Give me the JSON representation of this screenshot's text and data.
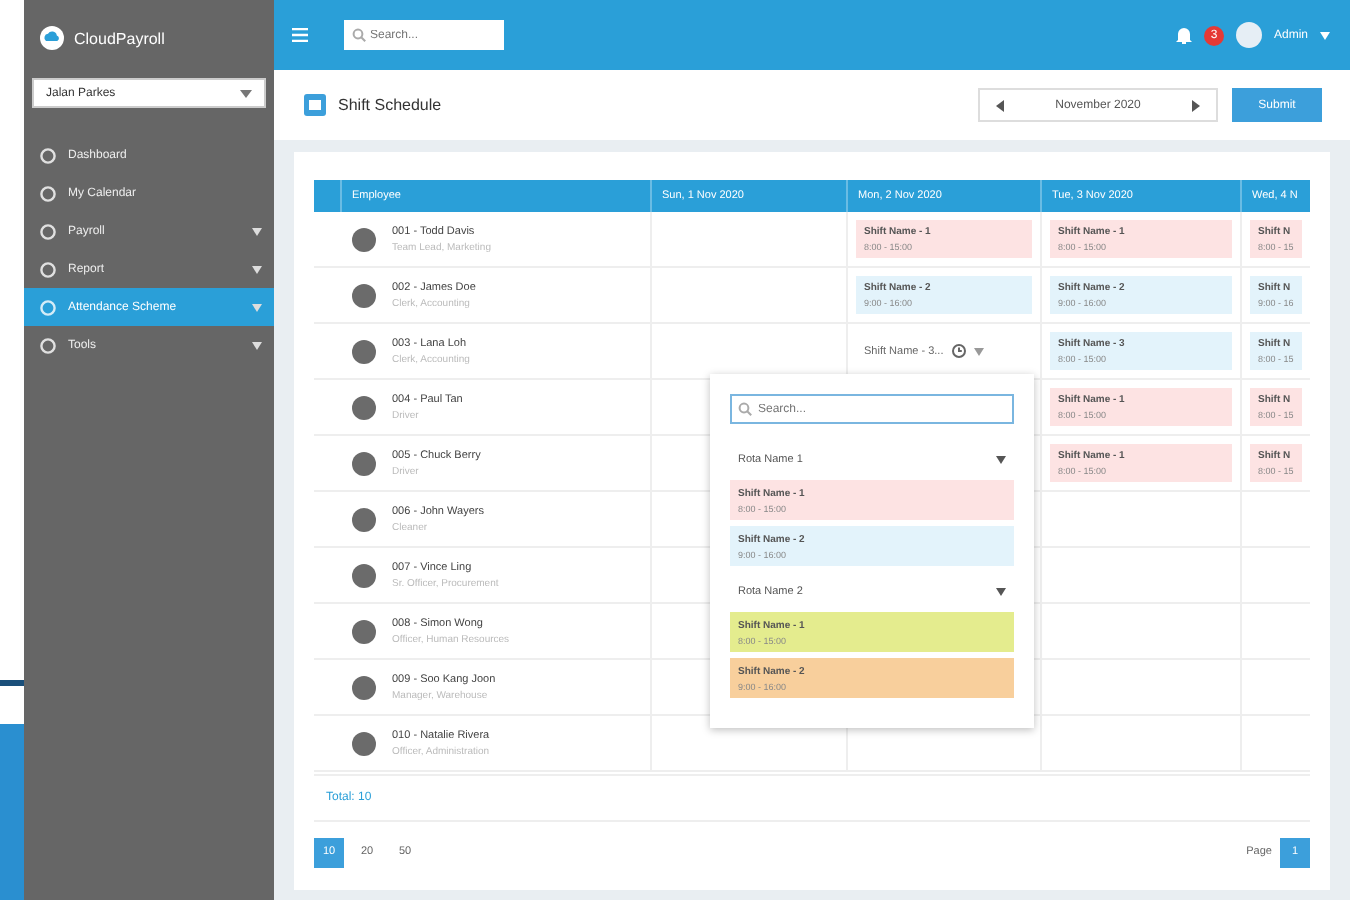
{
  "sidebar": {
    "logo": "CloudPayroll",
    "company_select": "Jalan Parkes",
    "items": [
      {
        "label": "Dashboard",
        "selected": false,
        "expandable": false
      },
      {
        "label": "My Calendar",
        "selected": false,
        "expandable": false
      },
      {
        "label": "Payroll",
        "selected": false,
        "expandable": true
      },
      {
        "label": "Report",
        "selected": false,
        "expandable": true
      },
      {
        "label": "Attendance Scheme",
        "selected": true,
        "expandable": true
      },
      {
        "label": "Tools",
        "selected": false,
        "expandable": true
      }
    ]
  },
  "topbar": {
    "search": {
      "placeholder": "Search..."
    },
    "notification_count": "3",
    "user": "Admin"
  },
  "page": {
    "title": "Shift Schedule",
    "month": "November 2020",
    "submit": "Submit"
  },
  "table": {
    "columns": [
      "Employee",
      "Sun, 1 Nov 2020",
      "Mon, 2 Nov 2020",
      "Tue, 3 Nov 2020",
      "Wed, 4 N"
    ],
    "rows": [
      {
        "cells": [
          {
            "kind": "employee",
            "name": "001 - Todd Davis",
            "subtitle": "Team Lead, Marketing"
          },
          {
            "kind": "empty"
          },
          {
            "kind": "shift",
            "name": "Shift Name - 1",
            "time": "8:00 - 15:00",
            "color": "#fde3e3"
          },
          {
            "kind": "shift",
            "name": "Shift Name - 1",
            "time": "8:00 - 15:00",
            "color": "#fde3e3"
          },
          {
            "kind": "shift",
            "name": "Shift N",
            "time": "8:00 - 15",
            "color": "#fde3e3"
          }
        ]
      },
      {
        "cells": [
          {
            "kind": "employee",
            "name": "002 - James Doe",
            "subtitle": "Clerk, Accounting"
          },
          {
            "kind": "empty"
          },
          {
            "kind": "shift",
            "name": "Shift Name - 2",
            "time": "9:00 - 16:00",
            "color": "#e3f3fb"
          },
          {
            "kind": "shift",
            "name": "Shift Name - 2",
            "time": "9:00 - 16:00",
            "color": "#e3f3fb"
          },
          {
            "kind": "shift",
            "name": "Shift N",
            "time": "9:00 - 16",
            "color": "#e3f3fb"
          }
        ]
      },
      {
        "cells": [
          {
            "kind": "employee",
            "name": "003 - Lana Loh",
            "subtitle": "Clerk, Accounting"
          },
          {
            "kind": "empty"
          },
          {
            "kind": "picker",
            "name": "Shift Name - 3..."
          },
          {
            "kind": "shift",
            "name": "Shift Name - 3",
            "time": "8:00 - 15:00",
            "color": "#e3f3fb"
          },
          {
            "kind": "shift",
            "name": "Shift N",
            "time": "8:00 - 15",
            "color": "#e3f3fb"
          }
        ]
      },
      {
        "cells": [
          {
            "kind": "employee",
            "name": "004 - Paul Tan",
            "subtitle": "Driver"
          },
          {
            "kind": "empty"
          },
          {
            "kind": "empty"
          },
          {
            "kind": "shift",
            "name": "Shift Name - 1",
            "time": "8:00 - 15:00",
            "color": "#fde3e3"
          },
          {
            "kind": "shift",
            "name": "Shift N",
            "time": "8:00 - 15",
            "color": "#fde3e3"
          }
        ]
      },
      {
        "cells": [
          {
            "kind": "employee",
            "name": "005 - Chuck Berry",
            "subtitle": "Driver"
          },
          {
            "kind": "empty"
          },
          {
            "kind": "empty"
          },
          {
            "kind": "shift",
            "name": "Shift Name - 1",
            "time": "8:00 - 15:00",
            "color": "#fde3e3"
          },
          {
            "kind": "shift",
            "name": "Shift N",
            "time": "8:00 - 15",
            "color": "#fde3e3"
          }
        ]
      },
      {
        "cells": [
          {
            "kind": "employee",
            "name": "006 - John Wayers",
            "subtitle": "Cleaner"
          },
          {
            "kind": "empty"
          },
          {
            "kind": "empty"
          },
          {
            "kind": "empty"
          },
          {
            "kind": "empty"
          }
        ]
      },
      {
        "cells": [
          {
            "kind": "employee",
            "name": "007 - Vince Ling",
            "subtitle": "Sr. Officer, Procurement"
          },
          {
            "kind": "empty"
          },
          {
            "kind": "empty"
          },
          {
            "kind": "empty"
          },
          {
            "kind": "empty"
          }
        ]
      },
      {
        "cells": [
          {
            "kind": "employee",
            "name": "008 - Simon Wong",
            "subtitle": "Officer, Human Resources"
          },
          {
            "kind": "empty"
          },
          {
            "kind": "empty"
          },
          {
            "kind": "empty"
          },
          {
            "kind": "empty"
          }
        ]
      },
      {
        "cells": [
          {
            "kind": "employee",
            "name": "009 - Soo Kang Joon",
            "subtitle": "Manager, Warehouse"
          },
          {
            "kind": "empty"
          },
          {
            "kind": "empty"
          },
          {
            "kind": "empty"
          },
          {
            "kind": "empty"
          }
        ]
      },
      {
        "cells": [
          {
            "kind": "employee",
            "name": "010 - Natalie Rivera",
            "subtitle": "Officer, Administration"
          },
          {
            "kind": "empty"
          },
          {
            "kind": "empty"
          },
          {
            "kind": "empty"
          },
          {
            "kind": "empty"
          }
        ]
      }
    ],
    "total": "Total: 10"
  },
  "shift_picker": {
    "search": {
      "placeholder": "Search..."
    },
    "groups": [
      {
        "name": "Rota Name 1",
        "shifts": [
          {
            "name": "Shift Name - 1",
            "time": "8:00 - 15:00",
            "color": "#fde3e3"
          },
          {
            "name": "Shift Name - 2",
            "time": "9:00 - 16:00",
            "color": "#e3f3fb"
          }
        ]
      },
      {
        "name": "Rota Name 2",
        "shifts": [
          {
            "name": "Shift Name - 1",
            "time": "8:00 - 15:00",
            "color": "#e4ec8e"
          },
          {
            "name": "Shift Name - 2",
            "time": "9:00 - 16:00",
            "color": "#f8cf9c"
          }
        ]
      }
    ]
  },
  "pagination": {
    "sizes": [
      {
        "label": "10",
        "selected": true
      },
      {
        "label": "20",
        "selected": false
      },
      {
        "label": "50",
        "selected": false
      }
    ],
    "page_label": "Page",
    "pages": [
      {
        "label": "1",
        "selected": true
      }
    ]
  }
}
